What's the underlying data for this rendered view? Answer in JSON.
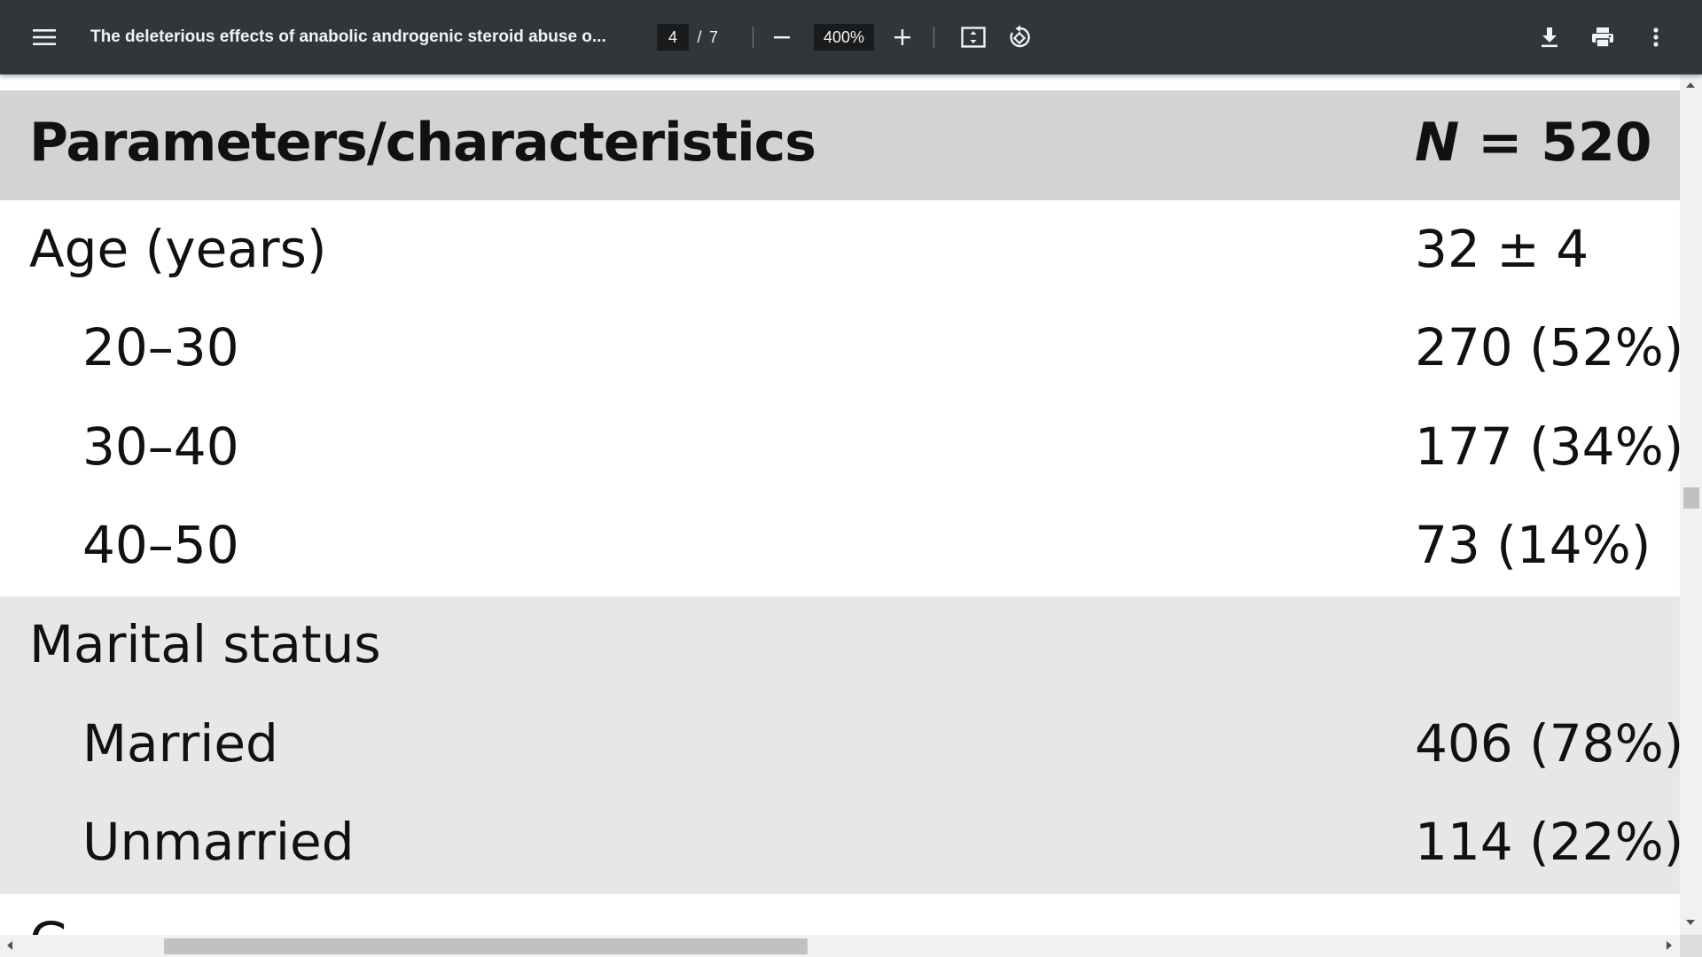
{
  "toolbar": {
    "title": "The deleterious effects of anabolic androgenic steroid abuse o...",
    "page_current": "4",
    "page_separator": "/",
    "page_total": "7",
    "zoom": "400%",
    "icons": {
      "menu": "menu-icon",
      "zoom_out": "minus-icon",
      "zoom_in": "plus-icon",
      "fit": "fit-to-page-icon",
      "rotate": "rotate-icon",
      "download": "download-icon",
      "print": "print-icon",
      "more": "more-vert-icon"
    }
  },
  "table": {
    "header": {
      "label": "Parameters/characteristics",
      "value_n": "N",
      "value_eq": " = 520"
    },
    "rows": [
      {
        "label": "Age (years)",
        "value": "32 ± 4"
      },
      {
        "label": "20–30",
        "value": "270 (52%)"
      },
      {
        "label": "30–40",
        "value": "177 (34%)"
      },
      {
        "label": "40–50",
        "value": "73 (14%)"
      },
      {
        "label": "Marital status",
        "value": ""
      },
      {
        "label": "Married",
        "value": "406 (78%)"
      },
      {
        "label": "Unmarried",
        "value": "114 (22%)"
      },
      {
        "label": "G",
        "value": ""
      }
    ]
  },
  "colors": {
    "toolbar_bg": "#323639",
    "header_bg": "#d2d3d5",
    "band_bg": "#e6e7e9"
  }
}
